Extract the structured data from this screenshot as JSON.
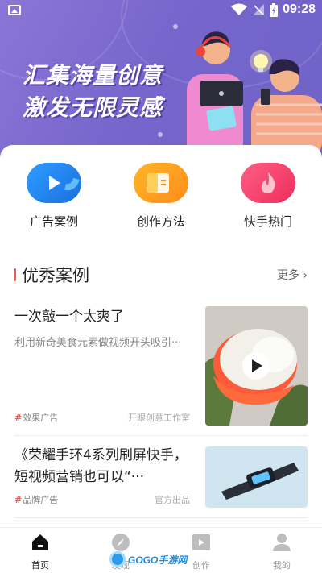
{
  "status_bar": {
    "time": "09:28"
  },
  "hero": {
    "line1": "汇集海量创意",
    "line2": "激发无限灵感"
  },
  "categories": [
    {
      "label": "广告案例",
      "icon": "play-icon",
      "color": "#1e88f0"
    },
    {
      "label": "创作方法",
      "icon": "document-icon",
      "color": "#ff9b1f"
    },
    {
      "label": "快手热门",
      "icon": "flame-icon",
      "color": "#f0436a"
    }
  ],
  "section": {
    "title": "优秀案例",
    "more": "更多"
  },
  "cases": [
    {
      "title": "一次敲一个太爽了",
      "desc": "利用新奇美食元素做视频开头吸引···",
      "tag": "效果广告",
      "source": "开眼创意工作室",
      "thumb_icon": "play-icon"
    },
    {
      "title": "《荣耀手环4系列刷屏快手，短视频营销也可以“···",
      "tag": "品牌广告",
      "source": "官方出品"
    }
  ],
  "tabbar": [
    {
      "label": "首页",
      "icon": "home-icon",
      "active": true
    },
    {
      "label": "发现",
      "icon": "compass-icon",
      "active": false
    },
    {
      "label": "创作",
      "icon": "video-icon",
      "active": false
    },
    {
      "label": "我的",
      "icon": "user-icon",
      "active": false
    }
  ],
  "watermark": {
    "text": "GOGO手游网"
  },
  "colors": {
    "accent": "#f05a4c",
    "hero_bg": "#7766cc"
  }
}
